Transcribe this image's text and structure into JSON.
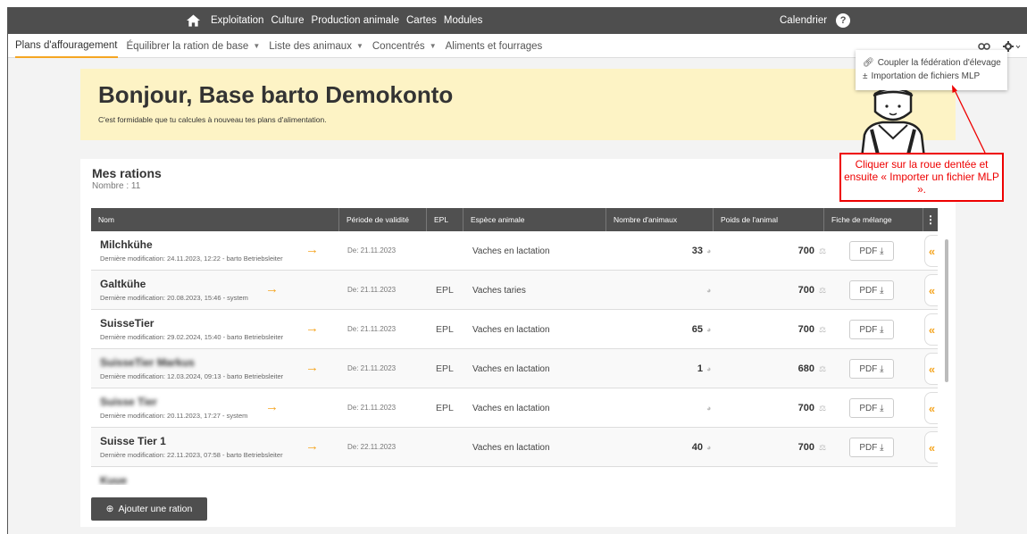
{
  "topbar": {
    "items": [
      "Exploitation",
      "Culture",
      "Production animale",
      "Cartes",
      "Modules"
    ],
    "calendar": "Calendrier",
    "help": "?"
  },
  "subnav": {
    "tabs": [
      {
        "label": "Plans d'affouragement",
        "dropdown": false
      },
      {
        "label": "Équilibrer la ration de base",
        "dropdown": true
      },
      {
        "label": "Liste des animaux",
        "dropdown": true
      },
      {
        "label": "Concentrés",
        "dropdown": true
      },
      {
        "label": "Aliments et fourrages",
        "dropdown": false
      }
    ]
  },
  "dropdown_menu": {
    "items": [
      "Coupler la fédération d'élevage",
      "Importation de fichiers MLP"
    ]
  },
  "greeting": {
    "title": "Bonjour, Base barto Demokonto",
    "subtitle": "C'est formidable que tu calcules à nouveau tes plans d'alimentation."
  },
  "callout": {
    "text": "Cliquer sur la roue dentée et ensuite « Importer un fichier MLP »."
  },
  "rations": {
    "title": "Mes rations",
    "count": "Nombre : 11",
    "columns": [
      "Nom",
      "Période de validité",
      "EPL",
      "Espèce animale",
      "Nombre d'animaux",
      "Poids de l'animal",
      "Fiche de mélange"
    ],
    "rows": [
      {
        "name": "Milchkühe",
        "modified": "Dernière modification: 24.11.2023, 12:22 - barto Betriebsleiter",
        "period": "De: 21.11.2023",
        "epl": "",
        "species": "Vaches en lactation",
        "animals": "33",
        "weight": "700",
        "pdf": "PDF",
        "blur": false
      },
      {
        "name": "Galtkühe",
        "modified": "Dernière modification: 20.08.2023, 15:46 - system",
        "period": "De: 21.11.2023",
        "epl": "EPL",
        "species": "Vaches taries",
        "animals": "",
        "weight": "700",
        "pdf": "PDF",
        "blur": false
      },
      {
        "name": "SuisseTier",
        "modified": "Dernière modification: 29.02.2024, 15:40 - barto Betriebsleiter",
        "period": "De: 21.11.2023",
        "epl": "EPL",
        "species": "Vaches en lactation",
        "animals": "65",
        "weight": "700",
        "pdf": "PDF",
        "blur": false
      },
      {
        "name": "SuisseTier Markus",
        "modified": "Dernière modification: 12.03.2024, 09:13 - barto Betriebsleiter",
        "period": "De: 21.11.2023",
        "epl": "EPL",
        "species": "Vaches en lactation",
        "animals": "1",
        "weight": "680",
        "pdf": "PDF",
        "blur": true
      },
      {
        "name": "Suisse Tier",
        "modified": "Dernière modification: 20.11.2023, 17:27 - system",
        "period": "De: 21.11.2023",
        "epl": "EPL",
        "species": "Vaches en lactation",
        "animals": "",
        "weight": "700",
        "pdf": "PDF",
        "blur": true
      },
      {
        "name": "Suisse Tier 1",
        "modified": "Dernière modification: 22.11.2023, 07:58 - barto Betriebsleiter",
        "period": "De: 22.11.2023",
        "epl": "",
        "species": "Vaches en lactation",
        "animals": "40",
        "weight": "700",
        "pdf": "PDF",
        "blur": false
      },
      {
        "name": "Kuue",
        "modified": "",
        "period": "",
        "epl": "",
        "species": "",
        "animals": "",
        "weight": "",
        "pdf": "",
        "blur": true
      }
    ]
  },
  "add_button": "Ajouter une ration",
  "colors": {
    "accent": "#f5a623",
    "dark": "#4e4e4e",
    "callout": "#e00000",
    "greeting_bg": "#fdf3c5"
  }
}
